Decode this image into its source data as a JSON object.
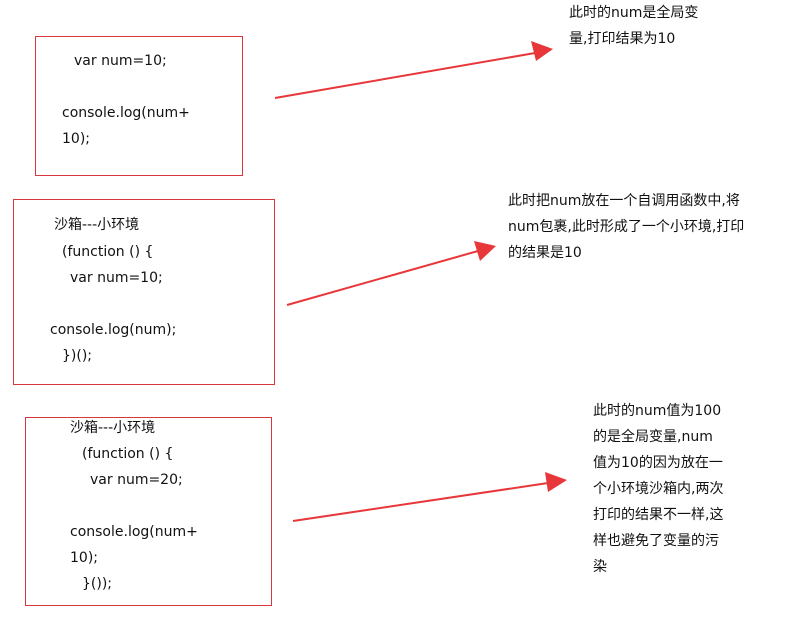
{
  "blocks": [
    {
      "code": [
        "var num=10;",
        "",
        "console.log(num+",
        "10);"
      ],
      "note": [
        "此时的num是全局变",
        "量,打印结果为10"
      ]
    },
    {
      "code": [
        "沙箱---小环境",
        "(function () {",
        "var num=10;",
        "",
        "console.log(num);",
        "})();"
      ],
      "note": [
        "此时把num放在一个自调用函数中,将",
        "num包裹,此时形成了一个小环境,打印",
        "的结果是10"
      ]
    },
    {
      "code": [
        "沙箱---小环境",
        "(function () {",
        "var num=20;",
        "",
        "console.log(num+",
        "10);",
        "}());"
      ],
      "note": [
        "此时的num值为100",
        "的是全局变量,num",
        "值为10的因为放在一",
        "个小环境沙箱内,两次",
        "打印的结果不一样,这",
        "样也避免了变量的污",
        "染"
      ]
    }
  ],
  "colors": {
    "box_border": "#d9363e",
    "arrow": "#e8373a"
  }
}
